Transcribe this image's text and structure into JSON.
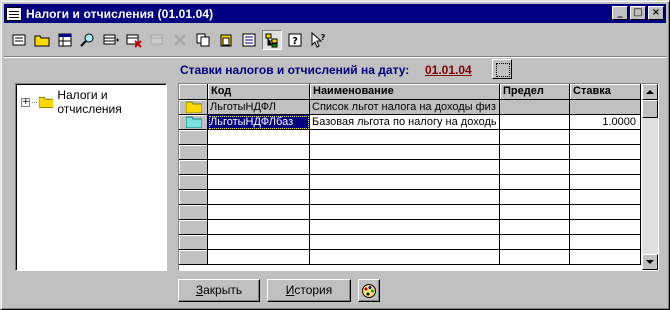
{
  "window": {
    "title": "Налоги и отчисления (01.01.04)",
    "buttons": {
      "minimize": "_",
      "maximize": "□",
      "close": "×"
    }
  },
  "toolbar": {
    "icons": [
      "new-doc-icon",
      "open-folder-icon",
      "grid-icon",
      "find-icon",
      "insert-row-icon",
      "delete-row-icon",
      "disabled-tool-icon",
      "copy-icon",
      "paste-icon",
      "list-icon",
      "hierarchy-icon",
      "help-icon",
      "context-help-icon"
    ],
    "help_label": "?"
  },
  "header": {
    "label": "Ставки налогов и отчислений на дату:",
    "date": "01.01.04"
  },
  "tree": {
    "expand_symbol": "+",
    "root_label": "Налоги и отчисления"
  },
  "table": {
    "columns": [
      "Код",
      "Наименование",
      "Предел",
      "Ставка"
    ],
    "rows": [
      {
        "code": "ЛьготыНДФЛ",
        "name": "Список льгот налога на доходы физ",
        "limit": "",
        "rate": ""
      },
      {
        "code": "ЛьготыНДФЛбаз",
        "name": "Базовая льгота по налогу на доходь",
        "limit": "",
        "rate": "1.0000"
      }
    ],
    "empty_rows": 9
  },
  "buttons": {
    "close_accel": "З",
    "close_rest": "акрыть",
    "history_accel": "И",
    "history_rest": "стория"
  },
  "colors": {
    "titlebar": "#000080",
    "header_label": "#000080",
    "header_date": "#800000",
    "selection": "#000080"
  }
}
